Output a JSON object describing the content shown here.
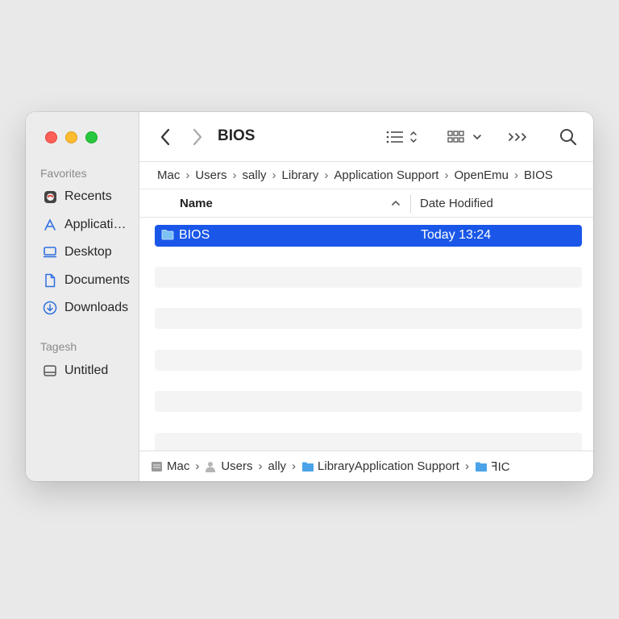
{
  "window": {
    "sidebar": {
      "favorites_label": "Favorites",
      "favorites": [
        {
          "label": "Recents",
          "icon": "clock-icon"
        },
        {
          "label": "Applicati…",
          "icon": "applications-icon"
        },
        {
          "label": "Desktop",
          "icon": "desktop-icon"
        },
        {
          "label": "Documents",
          "icon": "document-icon"
        },
        {
          "label": "Downloads",
          "icon": "download-icon"
        }
      ],
      "tags_label": "Tagesh",
      "tags": [
        {
          "label": "Untitled",
          "icon": "drive-icon"
        }
      ]
    },
    "toolbar": {
      "title": "BIOS",
      "back_icon": "chevron-left-icon",
      "forward_icon": "chevron-right-icon",
      "list_view_icon": "list-view-icon",
      "grid_view_icon": "grid-view-icon",
      "more_icon": "more-icon",
      "search_icon": "search-icon"
    },
    "breadcrumb": [
      "Mac",
      "Users",
      "sally",
      "Library",
      "Application Support",
      "OpenEmu",
      "BIOS"
    ],
    "columns": {
      "name": "Name",
      "date_modified": "Date Hodified"
    },
    "rows": [
      {
        "name": "BIOS",
        "date": "Today 13:24",
        "selected": true
      }
    ],
    "path_bar": [
      {
        "label": "Mac",
        "icon": "disk-icon"
      },
      {
        "label": "Users",
        "icon": "user-icon"
      },
      {
        "label": "ally",
        "icon": ""
      },
      {
        "label": "LibraryApplication Support",
        "icon": "folder-icon"
      },
      {
        "label": "ꟻIC",
        "icon": "folder-icon"
      }
    ]
  },
  "colors": {
    "selection": "#1a57e8",
    "accent": "#2f6fe0",
    "close": "#fe5f57",
    "minimize": "#febc2e",
    "zoom": "#28c840"
  }
}
